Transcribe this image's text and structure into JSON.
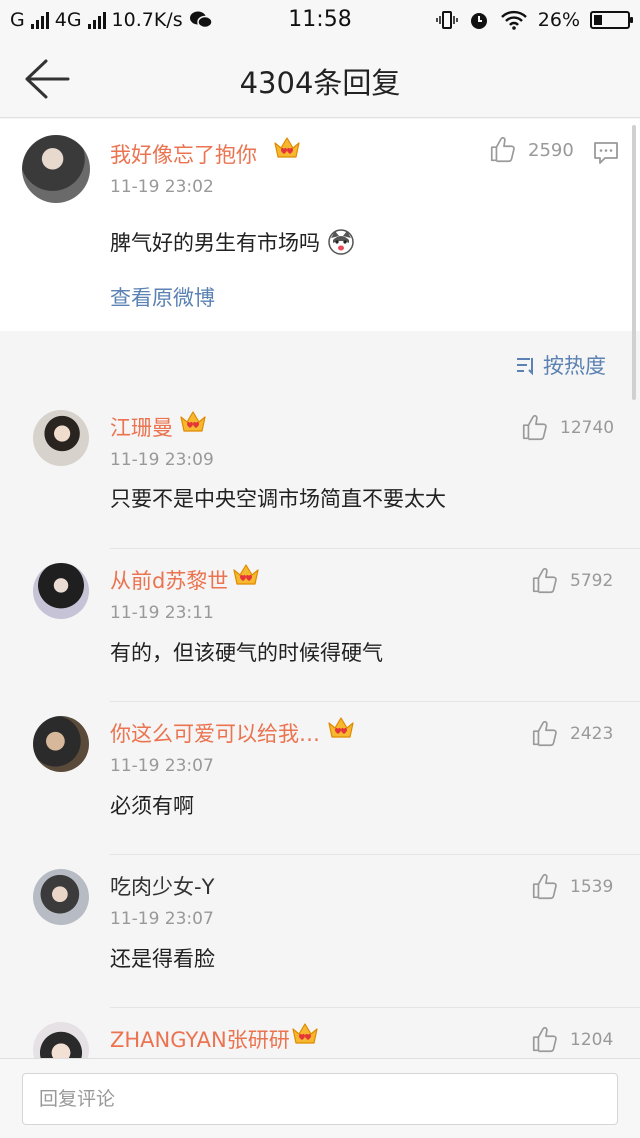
{
  "status_bar": {
    "carrier1": "G",
    "carrier2": "4G",
    "speed": "10.7K/s",
    "time": "11:58",
    "battery": "26%",
    "battery_level": 0.26
  },
  "header": {
    "title": "4304条回复"
  },
  "post": {
    "author": "我好像忘了抱你",
    "time": "11-19 23:02",
    "likes": "2590",
    "text": "脾气好的男生有市场吗",
    "view_original": "查看原微博"
  },
  "sort_label": "按热度",
  "comments": [
    {
      "author": "江珊曼",
      "time": "11-19 23:09",
      "likes": "12740",
      "text": "只要不是中央空调市场简直不要太大",
      "vip": true
    },
    {
      "author": "从前d苏黎世",
      "time": "11-19 23:11",
      "likes": "5792",
      "text": "有的，但该硬气的时候得硬气",
      "vip": true
    },
    {
      "author": "你这么可爱可以给我…",
      "time": "11-19 23:07",
      "likes": "2423",
      "text": "必须有啊",
      "vip": true
    },
    {
      "author": "吃肉少女-Y",
      "time": "11-19 23:07",
      "likes": "1539",
      "text": "还是得看脸",
      "vip": false
    },
    {
      "author": "ZHANGYAN张研研",
      "time": "",
      "likes": "1204",
      "text": "",
      "vip": true
    }
  ],
  "reply_placeholder": "回复评论",
  "colors": {
    "username": "#eb7350",
    "link": "#5b82b3",
    "meta": "#999999"
  }
}
